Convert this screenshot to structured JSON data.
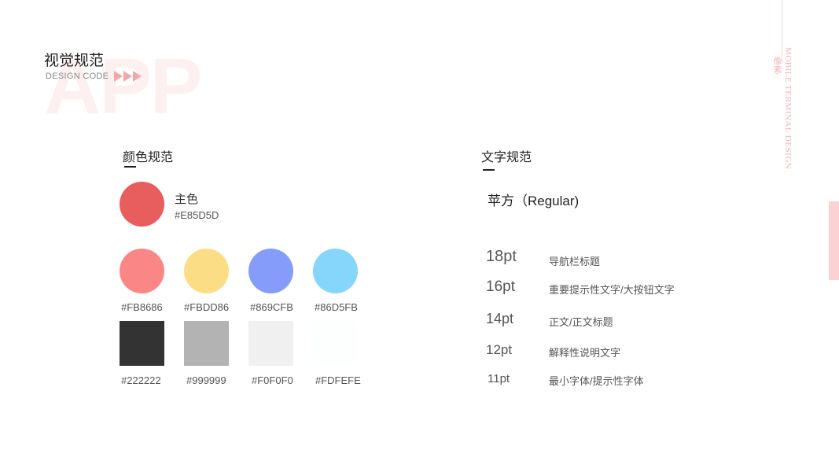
{
  "header": {
    "watermark": "APP",
    "title": "视觉规范",
    "subtitle": "DESIGN CODE"
  },
  "side": {
    "vertical_text": "MOBILE TERMINAL DESIGN",
    "vertical_cn": "像素"
  },
  "colors": {
    "section_title": "颜色规范",
    "primary": {
      "name": "主色",
      "hex": "#E85D5D",
      "color": "#E85D5D"
    },
    "circles": [
      {
        "hex": "#FB8686",
        "color": "#FB8686"
      },
      {
        "hex": "#FBDD86",
        "color": "#FBDD86"
      },
      {
        "hex": "#869CFB",
        "color": "#869CFB"
      },
      {
        "hex": "#86D5FB",
        "color": "#86D5FB"
      }
    ],
    "squares": [
      {
        "hex": "#222222",
        "color": "#333333"
      },
      {
        "hex": "#999999",
        "color": "#B3B3B3"
      },
      {
        "hex": "#F0F0F0",
        "color": "#F0F0F0"
      },
      {
        "hex": "#FDFEFE",
        "color": "#FDFEFE"
      }
    ]
  },
  "typography": {
    "section_title": "文字规范",
    "font_name": "苹方（Regular)",
    "sizes": [
      {
        "size": "18pt",
        "desc": "导航栏标题"
      },
      {
        "size": "16pt",
        "desc": "重要提示性文字/大按钮文字"
      },
      {
        "size": "14pt",
        "desc": "正文/正文标题"
      },
      {
        "size": "12pt",
        "desc": "解释性说明文字"
      },
      {
        "size": "11pt",
        "desc": "最小字体/提示性字体"
      }
    ]
  }
}
